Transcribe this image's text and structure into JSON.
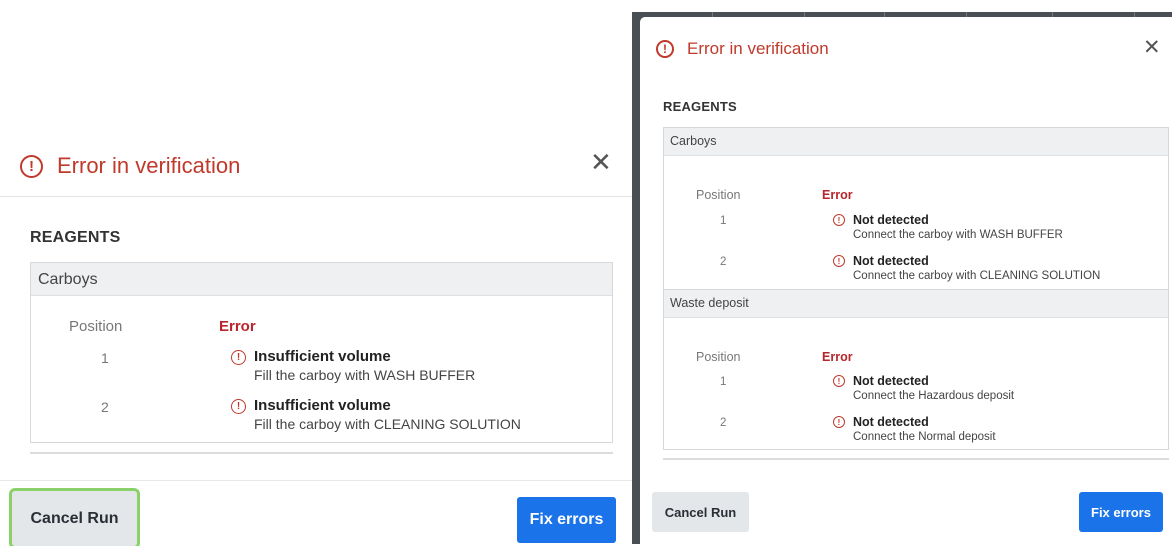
{
  "left_dialog": {
    "title": "Error in verification",
    "close_symbol": "✕",
    "error_icon": "!",
    "section": "REAGENTS",
    "group": {
      "header": "Carboys",
      "position_label": "Position",
      "error_label": "Error",
      "rows": [
        {
          "position": "1",
          "title": "Insufficient volume",
          "detail": "Fill the carboy with WASH BUFFER"
        },
        {
          "position": "2",
          "title": "Insufficient volume",
          "detail": "Fill the carboy with CLEANING SOLUTION"
        }
      ]
    },
    "cancel_label": "Cancel Run",
    "fix_label": "Fix errors"
  },
  "right_dialog": {
    "title": "Error in verification",
    "close_symbol": "✕",
    "error_icon": "!",
    "section": "REAGENTS",
    "groups": [
      {
        "header": "Carboys",
        "position_label": "Position",
        "error_label": "Error",
        "rows": [
          {
            "position": "1",
            "title": "Not detected",
            "detail": "Connect the carboy with WASH BUFFER"
          },
          {
            "position": "2",
            "title": "Not detected",
            "detail": "Connect the carboy with CLEANING SOLUTION"
          }
        ]
      },
      {
        "header": "Waste deposit",
        "position_label": "Position",
        "error_label": "Error",
        "rows": [
          {
            "position": "1",
            "title": "Not detected",
            "detail": "Connect the Hazardous deposit"
          },
          {
            "position": "2",
            "title": "Not detected",
            "detail": "Connect the Normal deposit"
          }
        ]
      }
    ],
    "cancel_label": "Cancel Run",
    "fix_label": "Fix errors"
  },
  "icons": {
    "error": "error-circle-icon",
    "close": "close-icon"
  },
  "colors": {
    "error_red": "#c0392b",
    "primary_blue": "#1a73e8",
    "focus_green": "#8bd16a"
  }
}
